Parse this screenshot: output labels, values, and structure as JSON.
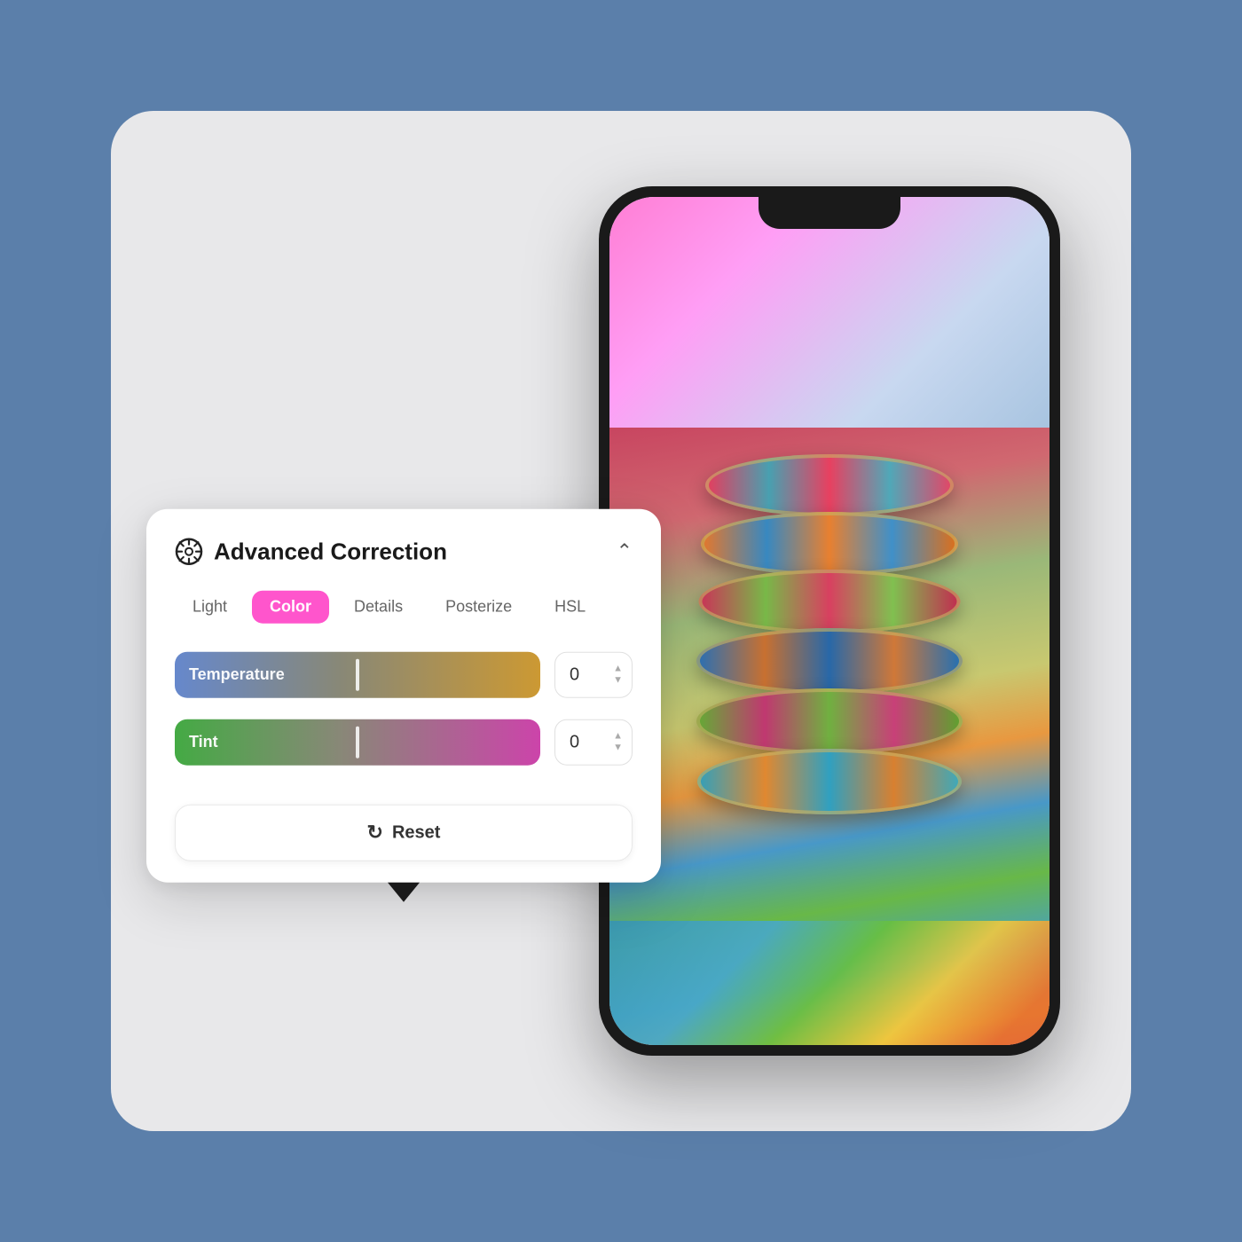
{
  "background_color": "#5b7faa",
  "card_color": "#e8e8ea",
  "panel": {
    "title": "Advanced Correction",
    "icon_name": "settings-circle-icon",
    "collapse_icon": "chevron-up-icon",
    "tabs": [
      {
        "id": "light",
        "label": "Light",
        "active": false
      },
      {
        "id": "color",
        "label": "Color",
        "active": true
      },
      {
        "id": "details",
        "label": "Details",
        "active": false
      },
      {
        "id": "posterize",
        "label": "Posterize",
        "active": false
      },
      {
        "id": "hsl",
        "label": "HSL",
        "active": false
      }
    ],
    "sliders": [
      {
        "id": "temperature",
        "label": "Temperature",
        "value": 0,
        "min": -100,
        "max": 100,
        "gradient_left": "#6688cc",
        "gradient_right": "#cc9933"
      },
      {
        "id": "tint",
        "label": "Tint",
        "value": 0,
        "min": -100,
        "max": 100,
        "gradient_left": "#44aa44",
        "gradient_right": "#cc44aa"
      }
    ],
    "reset_button_label": "Reset",
    "reset_icon": "↺"
  },
  "phone": {
    "has_notch": true,
    "gradient_top_colors": [
      "#ff7ed4",
      "#c8d8f0"
    ]
  }
}
